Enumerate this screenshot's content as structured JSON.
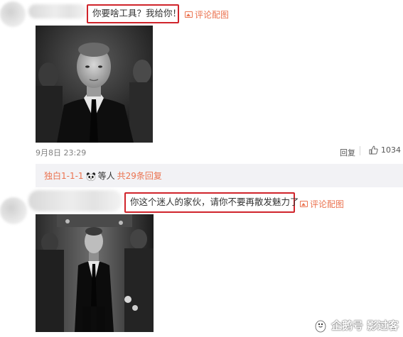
{
  "comment1": {
    "text": "你要啥工具？我给你！",
    "action": "评论配图",
    "date": "9月8日 23:29",
    "reply": "回复",
    "likes": "1034"
  },
  "replies": {
    "name": "独白1-1-1",
    "emoji": "panda-icon",
    "mid": "等人",
    "count": "共29条回复"
  },
  "comment2": {
    "text": "你这个迷人的家伙，请你不要再散发魅力了",
    "action": "评论配图"
  },
  "watermark": {
    "platform": "企鹅号",
    "author": "影过客"
  },
  "colors": {
    "accent": "#eb7350",
    "highlight": "#d0242b",
    "bar": "#f2f2f5"
  }
}
